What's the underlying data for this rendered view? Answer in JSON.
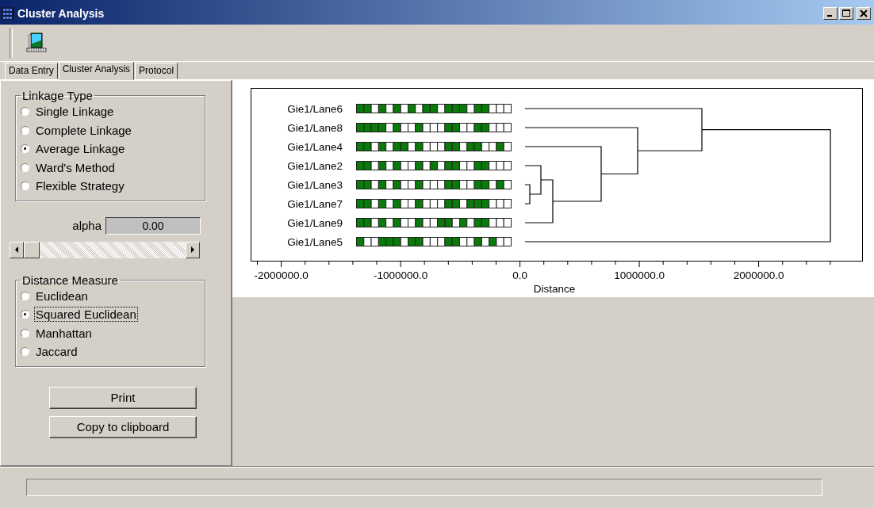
{
  "window": {
    "title": "Cluster Analysis"
  },
  "tabs": [
    {
      "label": "Data Entry",
      "selected": false
    },
    {
      "label": "Cluster Analysis",
      "selected": true
    },
    {
      "label": "Protocol",
      "selected": false
    }
  ],
  "linkage_type": {
    "title": "Linkage Type",
    "options": [
      {
        "label": "Single Linkage",
        "selected": false
      },
      {
        "label": "Complete Linkage",
        "selected": false
      },
      {
        "label": "Average Linkage",
        "selected": true
      },
      {
        "label": "Ward's Method",
        "selected": false
      },
      {
        "label": "Flexible Strategy",
        "selected": false
      }
    ]
  },
  "alpha": {
    "label": "alpha",
    "value": "0.00"
  },
  "alpha_slider": {
    "level": 0
  },
  "distance_measure": {
    "title": "Distance Measure",
    "options": [
      {
        "label": "Euclidean",
        "selected": false,
        "focused": false
      },
      {
        "label": "Squared Euclidean",
        "selected": true,
        "focused": true
      },
      {
        "label": "Manhattan",
        "selected": false,
        "focused": false
      },
      {
        "label": "Jaccard",
        "selected": false,
        "focused": false
      }
    ]
  },
  "buttons": [
    {
      "label": "Print"
    },
    {
      "label": "Copy to clipboard"
    }
  ],
  "progress": {
    "level": 0
  },
  "dendrogram": {
    "xlabel": "Distance",
    "xticks": [
      "-2000000.0",
      "-1000000.0",
      "0.0",
      "1000000.0",
      "2000000.0"
    ],
    "lanes": [
      {
        "label": "Gie1/Lane6",
        "bands": [
          true,
          true,
          false,
          true,
          false,
          true,
          false,
          true,
          false,
          true,
          true,
          false,
          true,
          true,
          true,
          false,
          true,
          true,
          false,
          false,
          false
        ]
      },
      {
        "label": "Gie1/Lane8",
        "bands": [
          true,
          true,
          true,
          true,
          false,
          true,
          false,
          false,
          true,
          false,
          false,
          false,
          true,
          true,
          false,
          false,
          true,
          true,
          false,
          false,
          false
        ]
      },
      {
        "label": "Gie1/Lane4",
        "bands": [
          true,
          true,
          false,
          true,
          false,
          true,
          true,
          false,
          true,
          false,
          false,
          false,
          true,
          true,
          false,
          true,
          true,
          false,
          false,
          true,
          false
        ]
      },
      {
        "label": "Gie1/Lane2",
        "bands": [
          true,
          true,
          false,
          true,
          false,
          true,
          false,
          false,
          true,
          false,
          true,
          false,
          true,
          true,
          false,
          false,
          true,
          true,
          false,
          false,
          false
        ]
      },
      {
        "label": "Gie1/Lane3",
        "bands": [
          true,
          true,
          false,
          true,
          false,
          true,
          false,
          false,
          true,
          false,
          false,
          false,
          true,
          true,
          false,
          false,
          true,
          true,
          false,
          true,
          false
        ]
      },
      {
        "label": "Gie1/Lane7",
        "bands": [
          true,
          true,
          false,
          true,
          false,
          true,
          false,
          false,
          true,
          false,
          false,
          false,
          true,
          true,
          false,
          true,
          true,
          true,
          false,
          false,
          false
        ]
      },
      {
        "label": "Gie1/Lane9",
        "bands": [
          true,
          true,
          false,
          true,
          false,
          true,
          false,
          false,
          true,
          false,
          false,
          true,
          true,
          false,
          true,
          false,
          true,
          true,
          false,
          false,
          false
        ]
      },
      {
        "label": "Gie1/Lane5",
        "bands": [
          true,
          false,
          false,
          true,
          true,
          true,
          false,
          true,
          true,
          false,
          false,
          false,
          true,
          true,
          false,
          false,
          true,
          false,
          true,
          false,
          false
        ]
      }
    ]
  }
}
